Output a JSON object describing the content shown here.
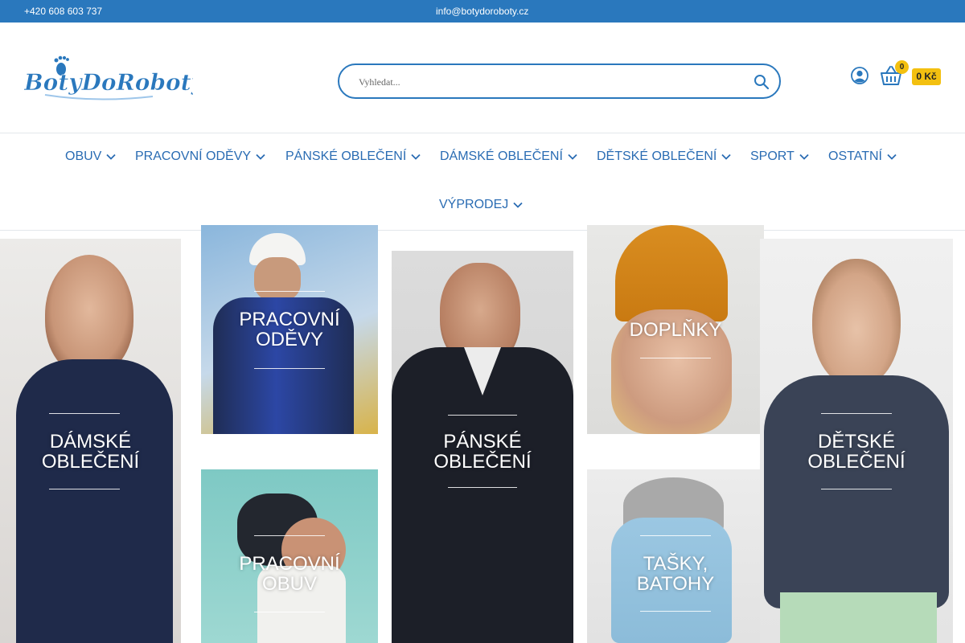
{
  "topbar": {
    "phone": "+420 608 603 737",
    "email": "info@botydoroboty.cz"
  },
  "header": {
    "logo_text": "BotyDoRoboty",
    "search_placeholder": "Vyhledat...",
    "cart_count": "0",
    "cart_total": "0 Kč"
  },
  "nav": {
    "items": [
      {
        "label": "OBUV"
      },
      {
        "label": "PRACOVNÍ ODĚVY"
      },
      {
        "label": "PÁNSKÉ OBLEČENÍ"
      },
      {
        "label": "DÁMSKÉ OBLEČENÍ"
      },
      {
        "label": "DĚTSKÉ OBLEČENÍ"
      },
      {
        "label": "SPORT"
      },
      {
        "label": "OSTATNÍ"
      },
      {
        "label": "VÝPRODEJ"
      }
    ]
  },
  "categories": {
    "damske": "DÁMSKÉ OBLEČENÍ",
    "pracovni_odevy": "PRACOVNÍ ODĚVY",
    "pracovni_obuv": "PRACOVNÍ OBUV",
    "panske": "PÁNSKÉ OBLEČENÍ",
    "doplnky": "DOPLŇKY",
    "tasky": "TAŠKY, BATOHY",
    "detske": "DĚTSKÉ OBLEČENÍ"
  },
  "colors": {
    "brand_blue": "#2a78bd",
    "nav_blue": "#2a6cb3",
    "accent_yellow": "#f3c010"
  }
}
